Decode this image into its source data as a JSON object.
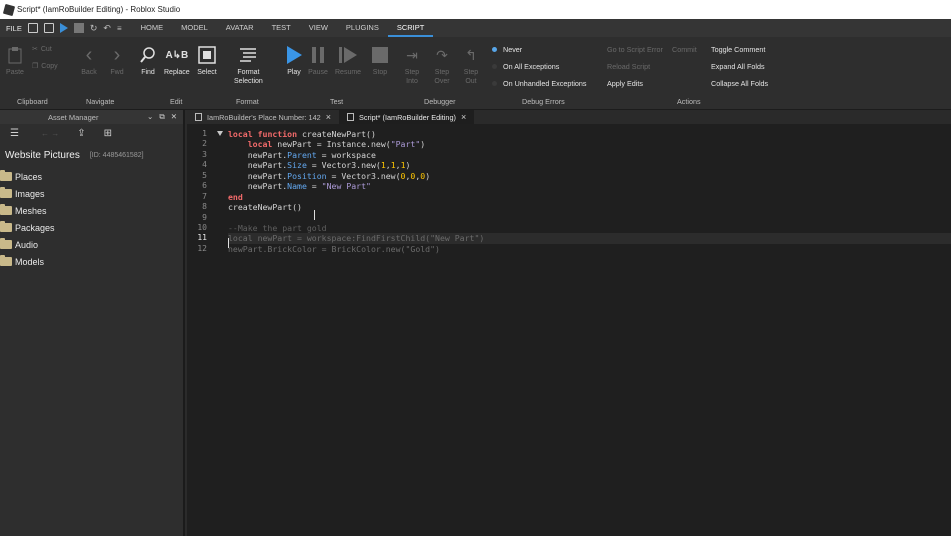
{
  "window": {
    "title": "Script* (IamRoBuilder Editing) - Roblox Studio"
  },
  "menu": {
    "file": "FILE",
    "tabs": [
      "HOME",
      "MODEL",
      "AVATAR",
      "TEST",
      "VIEW",
      "PLUGINS",
      "SCRIPT"
    ],
    "active_tab": "SCRIPT"
  },
  "ribbon": {
    "clipboard": {
      "paste": "Paste",
      "cut": "Cut",
      "copy": "Copy",
      "label": "Clipboard"
    },
    "navigate": {
      "back": "Back",
      "fwd": "Fwd",
      "label": "Navigate"
    },
    "edit": {
      "find": "Find",
      "replace": "Replace",
      "select": "Select",
      "label": "Edit"
    },
    "format": {
      "format_selection": "Format\nSelection",
      "label": "Format"
    },
    "test": {
      "play": "Play",
      "pause": "Pause",
      "resume": "Resume",
      "stop": "Stop",
      "label": "Test"
    },
    "debugger": {
      "step_into": "Step\nInto",
      "step_over": "Step\nOver",
      "step_out": "Step\nOut",
      "label": "Debugger"
    },
    "debug_errors": {
      "never": "Never",
      "all": "On All Exceptions",
      "unhandled": "On Unhandled Exceptions",
      "label": "Debug Errors"
    },
    "actions": {
      "go_to_error": "Go to Script Error",
      "commit": "Commit",
      "reload": "Reload Script",
      "apply": "Apply Edits",
      "toggle_comment": "Toggle Comment",
      "expand_folds": "Expand All Folds",
      "collapse_folds": "Collapse All Folds",
      "label": "Actions"
    }
  },
  "asset_manager": {
    "title": "Asset Manager",
    "place_name": "Website Pictures",
    "place_id": "[ID: 4485461582]",
    "folders": [
      "Places",
      "Images",
      "Meshes",
      "Packages",
      "Audio",
      "Models"
    ]
  },
  "editor_tabs": [
    {
      "label": "IamRoBuilder's Place Number: 142",
      "active": false
    },
    {
      "label": "Script* (IamRoBuilder Editing)",
      "active": true
    }
  ],
  "code": {
    "line_numbers": [
      "1",
      "2",
      "3",
      "4",
      "5",
      "6",
      "7",
      "8",
      "9",
      "10",
      "11",
      "12"
    ],
    "current_line": 11
  }
}
